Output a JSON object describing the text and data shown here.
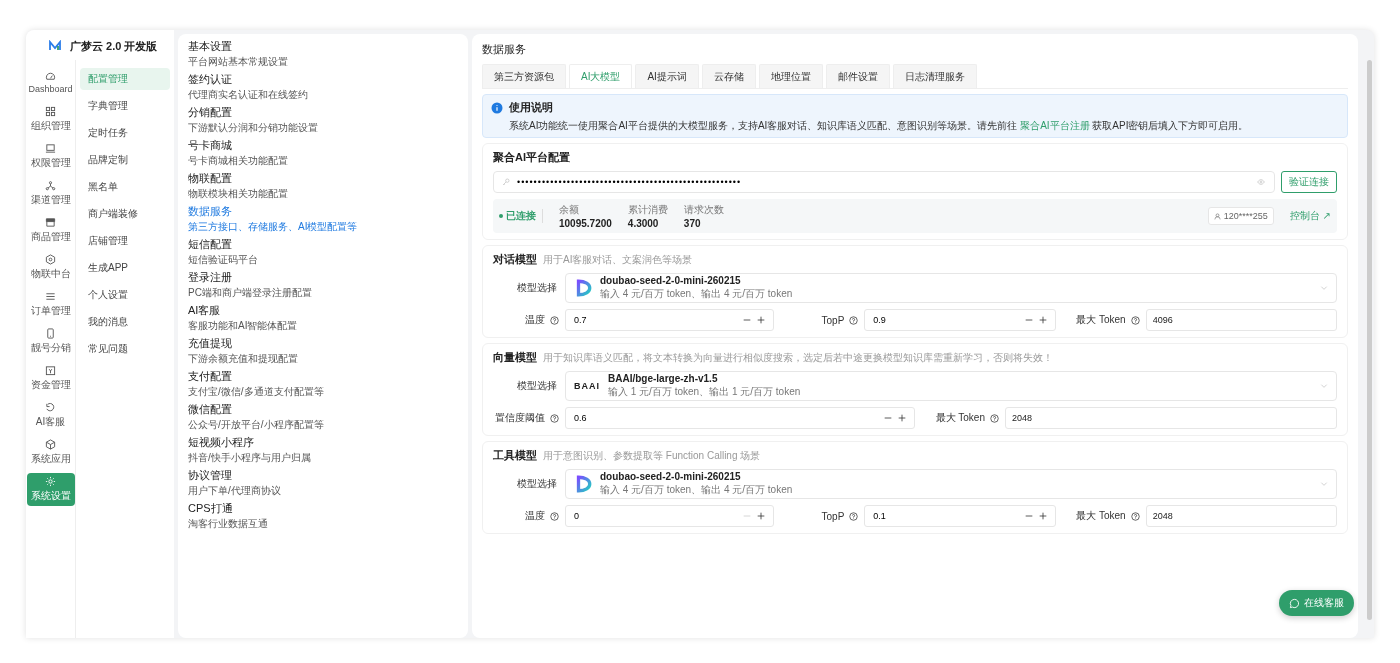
{
  "brand": {
    "title": "广梦云 2.0 开发版"
  },
  "rail": [
    {
      "label": "Dashboard",
      "selected": false
    },
    {
      "label": "组织管理",
      "selected": false
    },
    {
      "label": "权限管理",
      "selected": false
    },
    {
      "label": "渠道管理",
      "selected": false
    },
    {
      "label": "商品管理",
      "selected": false
    },
    {
      "label": "物联中台",
      "selected": false
    },
    {
      "label": "订单管理",
      "selected": false
    },
    {
      "label": "靓号分销",
      "selected": false
    },
    {
      "label": "资金管理",
      "selected": false
    },
    {
      "label": "AI客服",
      "selected": false
    },
    {
      "label": "系统应用",
      "selected": false
    },
    {
      "label": "系统设置",
      "selected": true
    }
  ],
  "submenu": [
    {
      "label": "配置管理",
      "selected": true
    },
    {
      "label": "字典管理",
      "selected": false
    },
    {
      "label": "定时任务",
      "selected": false
    },
    {
      "label": "品牌定制",
      "selected": false
    },
    {
      "label": "黑名单",
      "selected": false
    },
    {
      "label": "商户端装修",
      "selected": false
    },
    {
      "label": "店铺管理",
      "selected": false
    },
    {
      "label": "生成APP",
      "selected": false
    },
    {
      "label": "个人设置",
      "selected": false
    },
    {
      "label": "我的消息",
      "selected": false
    },
    {
      "label": "常见问题",
      "selected": false
    }
  ],
  "settings": [
    {
      "title": "基本设置",
      "desc": "平台网站基本常规设置",
      "selected": false
    },
    {
      "title": "签约认证",
      "desc": "代理商实名认证和在线签约",
      "selected": false
    },
    {
      "title": "分销配置",
      "desc": "下游默认分润和分销功能设置",
      "selected": false
    },
    {
      "title": "号卡商城",
      "desc": "号卡商城相关功能配置",
      "selected": false
    },
    {
      "title": "物联配置",
      "desc": "物联模块相关功能配置",
      "selected": false
    },
    {
      "title": "数据服务",
      "desc": "第三方接口、存储服务、AI模型配置等",
      "selected": true
    },
    {
      "title": "短信配置",
      "desc": "短信验证码平台",
      "selected": false
    },
    {
      "title": "登录注册",
      "desc": "PC端和商户端登录注册配置",
      "selected": false
    },
    {
      "title": "AI客服",
      "desc": "客服功能和AI智能体配置",
      "selected": false
    },
    {
      "title": "充值提现",
      "desc": "下游余额充值和提现配置",
      "selected": false
    },
    {
      "title": "支付配置",
      "desc": "支付宝/微信/多通道支付配置等",
      "selected": false
    },
    {
      "title": "微信配置",
      "desc": "公众号/开放平台/小程序配置等",
      "selected": false
    },
    {
      "title": "短视频小程序",
      "desc": "抖音/快手小程序与用户归属",
      "selected": false
    },
    {
      "title": "协议管理",
      "desc": "用户下单/代理商协议",
      "selected": false
    },
    {
      "title": "CPS打通",
      "desc": "淘客行业数据互通",
      "selected": false
    }
  ],
  "main": {
    "title": "数据服务",
    "tabs": [
      {
        "label": "第三方资源包",
        "selected": false
      },
      {
        "label": "AI大模型",
        "selected": true
      },
      {
        "label": "AI提示词",
        "selected": false
      },
      {
        "label": "云存储",
        "selected": false
      },
      {
        "label": "地理位置",
        "selected": false
      },
      {
        "label": "邮件设置",
        "selected": false
      },
      {
        "label": "日志清理服务",
        "selected": false
      }
    ],
    "notice": {
      "title": "使用说明",
      "text_before": "系统AI功能统一使用聚合AI平台提供的大模型服务，支持AI客服对话、知识库语义匹配、意图识别等场景。请先前往",
      "link": "聚合AI平台注册",
      "text_after": "获取API密钥后填入下方即可启用。"
    },
    "platform": {
      "title": "聚合AI平台配置",
      "api_key": "••••••••••••••••••••••••••••••••••••••••••••••••••••••",
      "verify_button": "验证连接",
      "status": "已连接",
      "connected": true,
      "stats": [
        {
          "label": "余额",
          "value": "10095.7200"
        },
        {
          "label": "累计消费",
          "value": "4.3000"
        },
        {
          "label": "请求次数",
          "value": "370"
        }
      ],
      "account": "120****255",
      "console_link": "控制台 ↗"
    },
    "models": [
      {
        "title": "对话模型",
        "hint": "用于AI客服对话、文案润色等场景",
        "select_label": "模型选择",
        "model_name": "doubao-seed-2-0-mini-260215",
        "price": "输入 4 元/百万 token、输出 4 元/百万 token",
        "params": [
          {
            "kind": "stepper",
            "label": "温度",
            "value": "0.7",
            "min_disabled": false
          },
          {
            "kind": "stepper",
            "label": "TopP",
            "value": "0.9",
            "min_disabled": false
          },
          {
            "kind": "text",
            "label": "最大 Token",
            "value": "4096"
          }
        ]
      },
      {
        "title": "向量模型",
        "hint": "用于知识库语义匹配，将文本转换为向量进行相似度搜索，选定后若中途更换模型知识库需重新学习，否则将失效！",
        "select_label": "模型选择",
        "logo_text": "BAAI",
        "model_name": "BAAI/bge-large-zh-v1.5",
        "price": "输入 1 元/百万 token、输出 1 元/百万 token",
        "params": [
          {
            "kind": "stepper",
            "label": "置信度阈值",
            "value": "0.6",
            "min_disabled": false
          },
          {
            "kind": "text",
            "label": "最大 Token",
            "value": "2048"
          }
        ]
      },
      {
        "title": "工具模型",
        "hint": "用于意图识别、参数提取等 Function Calling 场景",
        "select_label": "模型选择",
        "model_name": "doubao-seed-2-0-mini-260215",
        "price": "输入 4 元/百万 token、输出 4 元/百万 token",
        "params": [
          {
            "kind": "stepper",
            "label": "温度",
            "value": "0",
            "min_disabled": true
          },
          {
            "kind": "stepper",
            "label": "TopP",
            "value": "0.1",
            "min_disabled": false
          },
          {
            "kind": "text",
            "label": "最大 Token",
            "value": "2048"
          }
        ]
      }
    ]
  },
  "chat_button": "在线客服"
}
